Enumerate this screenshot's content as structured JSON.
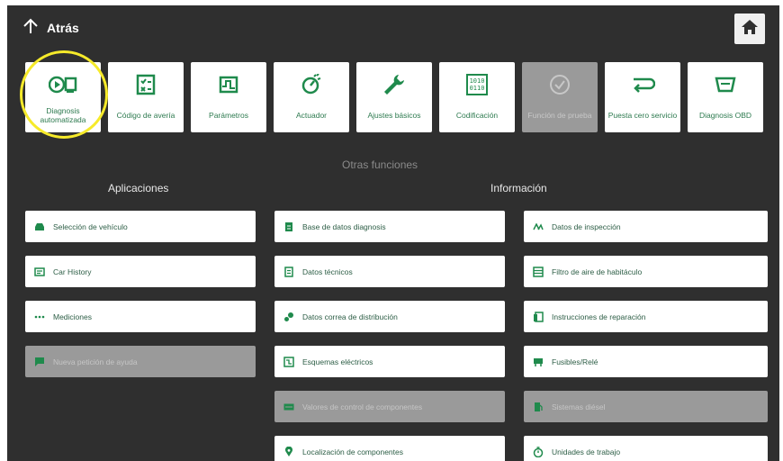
{
  "header": {
    "back_label": "Atrás"
  },
  "tiles": [
    {
      "label": "Diagnosis automatizada",
      "icon": "auto-diagnosis-icon",
      "disabled": false
    },
    {
      "label": "Código de avería",
      "icon": "fault-code-icon",
      "disabled": false
    },
    {
      "label": "Parámetros",
      "icon": "parameters-icon",
      "disabled": false
    },
    {
      "label": "Actuador",
      "icon": "actuator-icon",
      "disabled": false
    },
    {
      "label": "Ajustes básicos",
      "icon": "wrench-icon",
      "disabled": false
    },
    {
      "label": "Codificación",
      "icon": "coding-icon",
      "disabled": false
    },
    {
      "label": "Función de prueba",
      "icon": "check-circle-icon",
      "disabled": true
    },
    {
      "label": "Puesta cero servicio",
      "icon": "service-reset-icon",
      "disabled": false
    },
    {
      "label": "Diagnosis OBD",
      "icon": "obd-icon",
      "disabled": false
    }
  ],
  "otras_funciones": "Otras funciones",
  "aplicaciones": {
    "title": "Aplicaciones",
    "items": [
      {
        "label": "Selección de vehículo",
        "icon": "car-icon",
        "disabled": false
      },
      {
        "label": "Car History",
        "icon": "history-icon",
        "disabled": false
      },
      {
        "label": "Mediciones",
        "icon": "dots-icon",
        "disabled": false
      },
      {
        "label": "Nueva petición de ayuda",
        "icon": "chat-icon",
        "disabled": true
      }
    ]
  },
  "informacion": {
    "title": "Información",
    "col_a": [
      {
        "label": "Base de datos diagnosis",
        "icon": "database-icon",
        "disabled": false
      },
      {
        "label": "Datos técnicos",
        "icon": "document-icon",
        "disabled": false
      },
      {
        "label": "Datos correa de distribución",
        "icon": "belt-icon",
        "disabled": false
      },
      {
        "label": "Esquemas eléctricos",
        "icon": "wiring-icon",
        "disabled": false
      },
      {
        "label": "Valores de control de componentes",
        "icon": "component-values-icon",
        "disabled": true
      },
      {
        "label": "Localización de componentes",
        "icon": "location-pin-icon",
        "disabled": false
      }
    ],
    "col_b": [
      {
        "label": "Datos de inspección",
        "icon": "inspection-icon",
        "disabled": false
      },
      {
        "label": "Filtro de aire de habitáculo",
        "icon": "filter-icon",
        "disabled": false
      },
      {
        "label": "Instrucciones de reparación",
        "icon": "instructions-icon",
        "disabled": false
      },
      {
        "label": "Fusibles/Relé",
        "icon": "fuse-icon",
        "disabled": false
      },
      {
        "label": "Sistemas diésel",
        "icon": "fuel-pump-icon",
        "disabled": true
      },
      {
        "label": "Unidades de trabajo",
        "icon": "timer-icon",
        "disabled": false
      }
    ]
  },
  "colors": {
    "accent": "#1f8a4c",
    "background": "#2f2f2f",
    "highlight_ring": "#f6ea2a"
  }
}
